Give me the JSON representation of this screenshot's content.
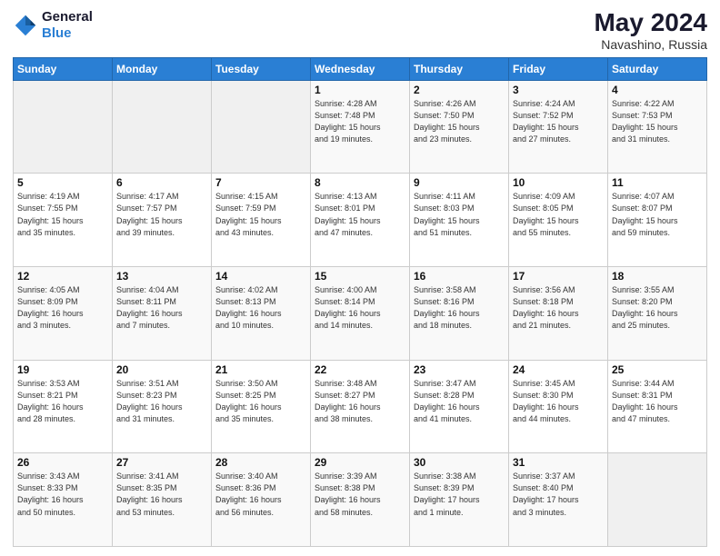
{
  "header": {
    "logo_line1": "General",
    "logo_line2": "Blue",
    "month_year": "May 2024",
    "location": "Navashino, Russia"
  },
  "weekdays": [
    "Sunday",
    "Monday",
    "Tuesday",
    "Wednesday",
    "Thursday",
    "Friday",
    "Saturday"
  ],
  "weeks": [
    [
      {
        "day": "",
        "info": ""
      },
      {
        "day": "",
        "info": ""
      },
      {
        "day": "",
        "info": ""
      },
      {
        "day": "1",
        "info": "Sunrise: 4:28 AM\nSunset: 7:48 PM\nDaylight: 15 hours\nand 19 minutes."
      },
      {
        "day": "2",
        "info": "Sunrise: 4:26 AM\nSunset: 7:50 PM\nDaylight: 15 hours\nand 23 minutes."
      },
      {
        "day": "3",
        "info": "Sunrise: 4:24 AM\nSunset: 7:52 PM\nDaylight: 15 hours\nand 27 minutes."
      },
      {
        "day": "4",
        "info": "Sunrise: 4:22 AM\nSunset: 7:53 PM\nDaylight: 15 hours\nand 31 minutes."
      }
    ],
    [
      {
        "day": "5",
        "info": "Sunrise: 4:19 AM\nSunset: 7:55 PM\nDaylight: 15 hours\nand 35 minutes."
      },
      {
        "day": "6",
        "info": "Sunrise: 4:17 AM\nSunset: 7:57 PM\nDaylight: 15 hours\nand 39 minutes."
      },
      {
        "day": "7",
        "info": "Sunrise: 4:15 AM\nSunset: 7:59 PM\nDaylight: 15 hours\nand 43 minutes."
      },
      {
        "day": "8",
        "info": "Sunrise: 4:13 AM\nSunset: 8:01 PM\nDaylight: 15 hours\nand 47 minutes."
      },
      {
        "day": "9",
        "info": "Sunrise: 4:11 AM\nSunset: 8:03 PM\nDaylight: 15 hours\nand 51 minutes."
      },
      {
        "day": "10",
        "info": "Sunrise: 4:09 AM\nSunset: 8:05 PM\nDaylight: 15 hours\nand 55 minutes."
      },
      {
        "day": "11",
        "info": "Sunrise: 4:07 AM\nSunset: 8:07 PM\nDaylight: 15 hours\nand 59 minutes."
      }
    ],
    [
      {
        "day": "12",
        "info": "Sunrise: 4:05 AM\nSunset: 8:09 PM\nDaylight: 16 hours\nand 3 minutes."
      },
      {
        "day": "13",
        "info": "Sunrise: 4:04 AM\nSunset: 8:11 PM\nDaylight: 16 hours\nand 7 minutes."
      },
      {
        "day": "14",
        "info": "Sunrise: 4:02 AM\nSunset: 8:13 PM\nDaylight: 16 hours\nand 10 minutes."
      },
      {
        "day": "15",
        "info": "Sunrise: 4:00 AM\nSunset: 8:14 PM\nDaylight: 16 hours\nand 14 minutes."
      },
      {
        "day": "16",
        "info": "Sunrise: 3:58 AM\nSunset: 8:16 PM\nDaylight: 16 hours\nand 18 minutes."
      },
      {
        "day": "17",
        "info": "Sunrise: 3:56 AM\nSunset: 8:18 PM\nDaylight: 16 hours\nand 21 minutes."
      },
      {
        "day": "18",
        "info": "Sunrise: 3:55 AM\nSunset: 8:20 PM\nDaylight: 16 hours\nand 25 minutes."
      }
    ],
    [
      {
        "day": "19",
        "info": "Sunrise: 3:53 AM\nSunset: 8:21 PM\nDaylight: 16 hours\nand 28 minutes."
      },
      {
        "day": "20",
        "info": "Sunrise: 3:51 AM\nSunset: 8:23 PM\nDaylight: 16 hours\nand 31 minutes."
      },
      {
        "day": "21",
        "info": "Sunrise: 3:50 AM\nSunset: 8:25 PM\nDaylight: 16 hours\nand 35 minutes."
      },
      {
        "day": "22",
        "info": "Sunrise: 3:48 AM\nSunset: 8:27 PM\nDaylight: 16 hours\nand 38 minutes."
      },
      {
        "day": "23",
        "info": "Sunrise: 3:47 AM\nSunset: 8:28 PM\nDaylight: 16 hours\nand 41 minutes."
      },
      {
        "day": "24",
        "info": "Sunrise: 3:45 AM\nSunset: 8:30 PM\nDaylight: 16 hours\nand 44 minutes."
      },
      {
        "day": "25",
        "info": "Sunrise: 3:44 AM\nSunset: 8:31 PM\nDaylight: 16 hours\nand 47 minutes."
      }
    ],
    [
      {
        "day": "26",
        "info": "Sunrise: 3:43 AM\nSunset: 8:33 PM\nDaylight: 16 hours\nand 50 minutes."
      },
      {
        "day": "27",
        "info": "Sunrise: 3:41 AM\nSunset: 8:35 PM\nDaylight: 16 hours\nand 53 minutes."
      },
      {
        "day": "28",
        "info": "Sunrise: 3:40 AM\nSunset: 8:36 PM\nDaylight: 16 hours\nand 56 minutes."
      },
      {
        "day": "29",
        "info": "Sunrise: 3:39 AM\nSunset: 8:38 PM\nDaylight: 16 hours\nand 58 minutes."
      },
      {
        "day": "30",
        "info": "Sunrise: 3:38 AM\nSunset: 8:39 PM\nDaylight: 17 hours\nand 1 minute."
      },
      {
        "day": "31",
        "info": "Sunrise: 3:37 AM\nSunset: 8:40 PM\nDaylight: 17 hours\nand 3 minutes."
      },
      {
        "day": "",
        "info": ""
      }
    ]
  ]
}
